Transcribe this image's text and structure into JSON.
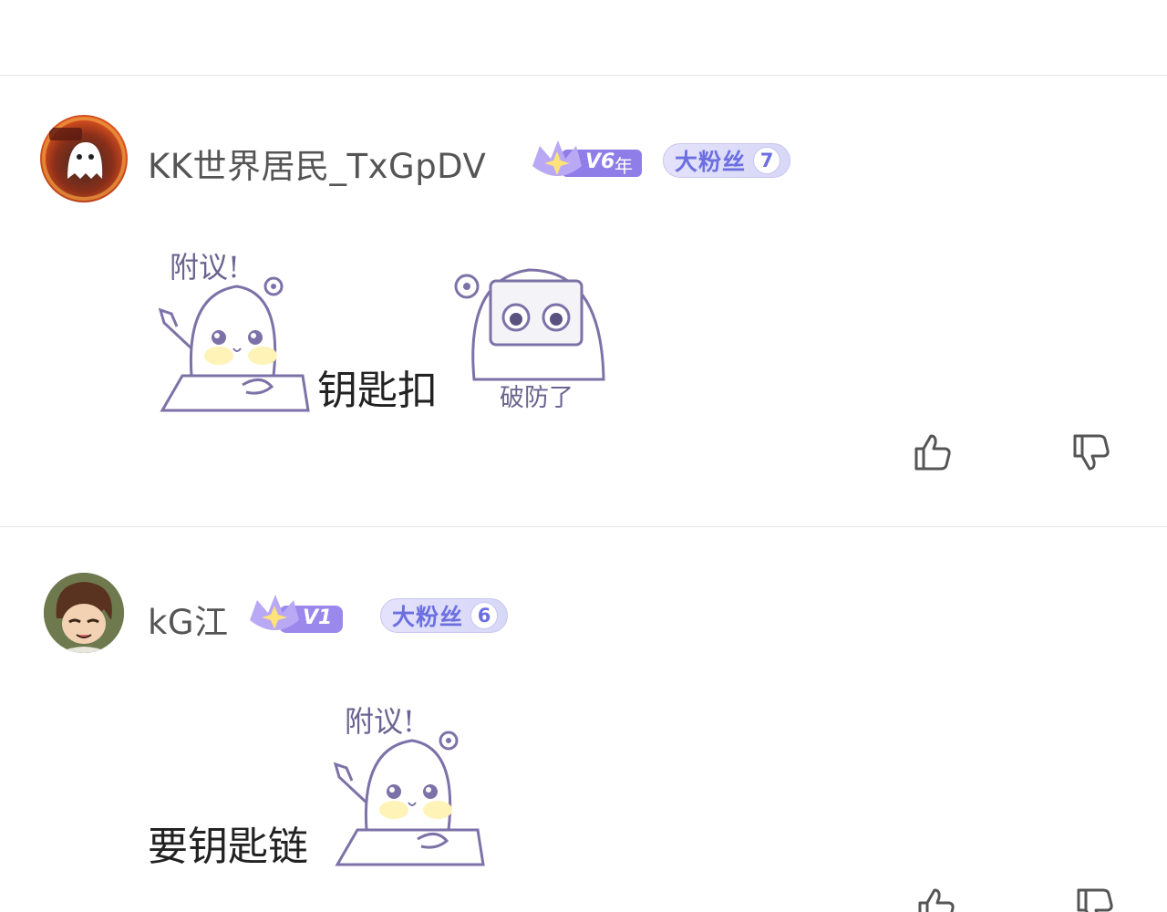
{
  "comments": [
    {
      "username": "KK世界居民_TxGpDV",
      "vip_level": "V6",
      "vip_suffix": "年",
      "fan_label": "大粉丝",
      "fan_level": "7",
      "sticker1_caption": "附议!",
      "text": "钥匙扣",
      "sticker2_caption": "破防了",
      "avatar_icon": "ghost-avatar-icon"
    },
    {
      "username": "kG江",
      "vip_level": "V1",
      "fan_label": "大粉丝",
      "fan_level": "6",
      "sticker1_caption": "附议!",
      "text": "要钥匙链",
      "avatar_icon": "anime-boy-avatar-icon"
    }
  ],
  "icons": {
    "like": "thumbs-up-icon",
    "dislike": "thumbs-down-icon"
  },
  "colors": {
    "accent": "#6b6fe0",
    "vip_purple": "#8f7de8",
    "divider": "#e6e6e6"
  }
}
